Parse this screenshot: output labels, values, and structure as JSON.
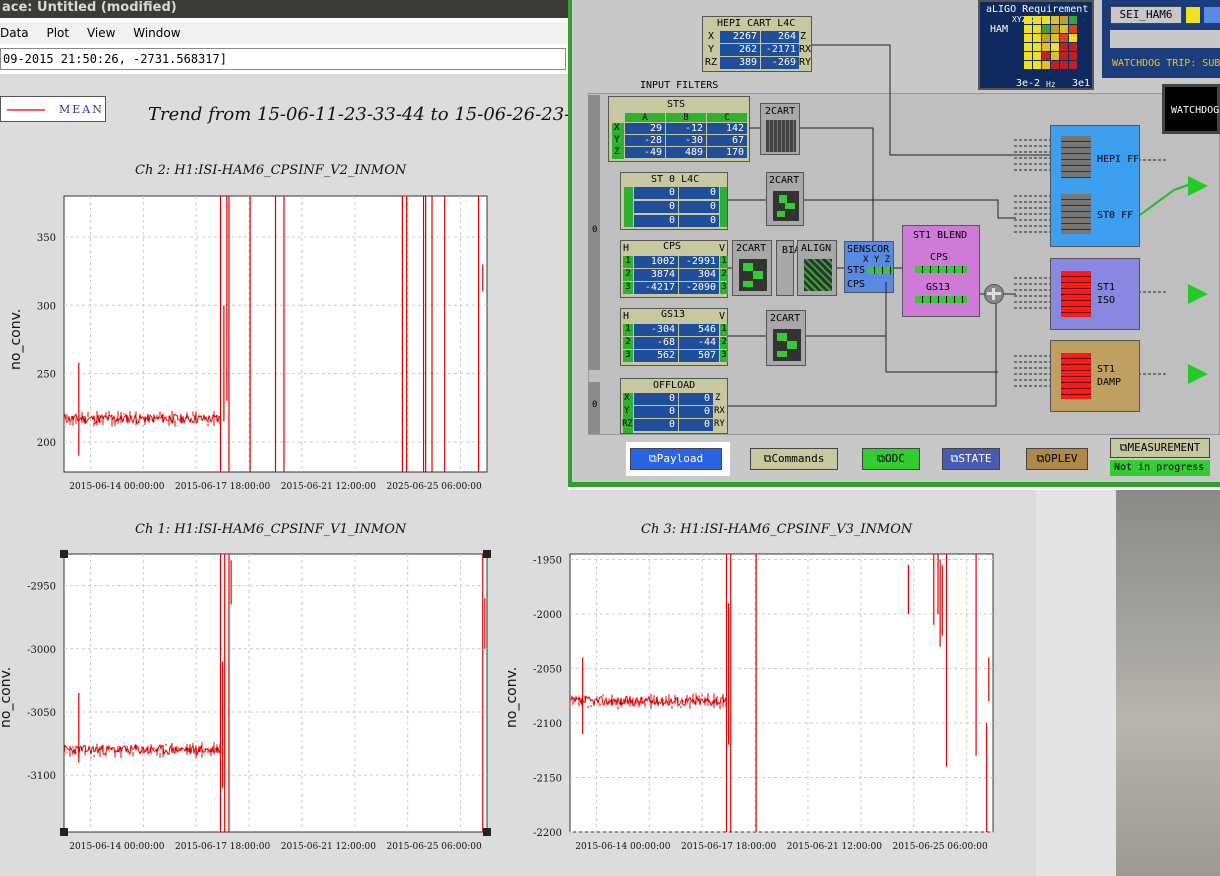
{
  "window": {
    "title": "ace: Untitled (modified)",
    "menu": [
      "Data",
      "Plot",
      "View",
      "Window"
    ],
    "readout": "09-2015 21:50:26, -2731.568317]"
  },
  "legend": {
    "label": "MEAN",
    "color": "#dd0000"
  },
  "trend_title": "Trend from 15-06-11-23-33-44 to 15-06-26-23-29-",
  "chart_data": [
    {
      "type": "line",
      "title": "Ch 2: H1:ISI-HAM6_CPSINF_V2_INMON",
      "ylabel": "no_conv.",
      "yticks": [
        200,
        250,
        300,
        350
      ],
      "xticks": [
        "2015-06-14 00:00:00",
        "2015-06-17 18:00:00",
        "2015-06-21 12:00:00",
        "2025-06-25 06:00:00"
      ],
      "ylim": [
        178,
        380
      ],
      "series": [
        {
          "color": "#dd0000",
          "baseline": 217,
          "values_description_free": true
        }
      ]
    },
    {
      "type": "line",
      "title": "Ch 1: H1:ISI-HAM6_CPSINF_V1_INMON",
      "ylabel": "no_conv.",
      "yticks": [
        -2950,
        -3000,
        -3050,
        -3100
      ],
      "xticks": [
        "2015-06-14 00:00:00",
        "2015-06-17 18:00:00",
        "2015-06-21 12:00:00",
        "2015-06-25 06:00:00"
      ],
      "ylim": [
        -3145,
        -2925
      ],
      "series": [
        {
          "color": "#dd0000",
          "baseline": -3080
        }
      ]
    },
    {
      "type": "line",
      "title": "Ch 3: H1:ISI-HAM6_CPSINF_V3_INMON",
      "ylabel": "no_conv.",
      "yticks": [
        -1950,
        -2000,
        -2050,
        -2100,
        -2150,
        -2200
      ],
      "xticks": [
        "2015-06-14 00:00:00",
        "2015-06-17 18:00:00",
        "2015-06-21 12:00:00",
        "2015-06-25 06:00:00"
      ],
      "ylim": [
        -2200,
        -1945
      ],
      "series": [
        {
          "color": "#dd0000",
          "baseline": -2080
        }
      ]
    }
  ],
  "medm": {
    "hepi_cart": {
      "title": "HEPI CART L4C",
      "rows": [
        [
          "X",
          "2267",
          "264",
          "Z"
        ],
        [
          "Y",
          "262",
          "-2171",
          "RX"
        ],
        [
          "RZ",
          "389",
          "-269",
          "RY"
        ]
      ]
    },
    "input_filters": "INPUT FILTERS",
    "sts": {
      "title": "STS",
      "cols": [
        "A",
        "B",
        "C"
      ],
      "rows": [
        [
          "X",
          "29",
          "-12",
          "142"
        ],
        [
          "Y",
          "-28",
          "-30",
          "67"
        ],
        [
          "Z",
          "-49",
          "489",
          "170"
        ]
      ]
    },
    "st0_l4c": {
      "title": "ST 0 L4C",
      "rows": [
        [
          "0",
          "0"
        ],
        [
          "0",
          "0"
        ],
        [
          "0",
          "0"
        ]
      ]
    },
    "cps": {
      "title": "CPS",
      "h": "H",
      "v": "V",
      "rows": [
        [
          "1",
          "1002",
          "-2991",
          "1"
        ],
        [
          "2",
          "3874",
          "304",
          "2"
        ],
        [
          "3",
          "-4217",
          "-2090",
          "3"
        ]
      ]
    },
    "gs13": {
      "title": "GS13",
      "h": "H",
      "v": "V",
      "rows": [
        [
          "1",
          "-304",
          "546",
          "1"
        ],
        [
          "2",
          "-68",
          "-44",
          "2"
        ],
        [
          "3",
          "562",
          "507",
          "3"
        ]
      ]
    },
    "offload": {
      "title": "OFFLOAD",
      "rows": [
        [
          "X",
          "0",
          "0",
          "Z"
        ],
        [
          "Y",
          "0",
          "0",
          "RX"
        ],
        [
          "RZ",
          "0",
          "0",
          "RY"
        ]
      ]
    },
    "cart_label": "2CART",
    "bias_label": "BIAS",
    "align_label": "ALIGN",
    "senscor": {
      "title": "SENSCOR",
      "xyz": "X Y Z",
      "sts": "STS",
      "cps": "CPS"
    },
    "st1_blend": {
      "title": "ST1 BLEND",
      "cps": "CPS",
      "gs13": "GS13"
    },
    "hepi_ff": "HEPI FF",
    "st0_ff": "ST0 FF",
    "st1_iso": "ST1\nISO",
    "st1_damp": "ST1\nDAMP",
    "aligo": {
      "title": "aLIGO Requirement",
      "ham": "HAM",
      "axes": "XYZRXRYRZ",
      "range_lo": "3e-2",
      "hz": "Hz",
      "range_hi": "3e1"
    },
    "sei_ham6": "SEI_HAM6",
    "watchdog_trip": "WATCHDOG TRIP: SUB",
    "watchdog": "WATCHDOG",
    "buttons": [
      "Payload",
      "Commands",
      "ODC",
      "STATE",
      "OPLEV",
      "MEASUREMENT"
    ],
    "measurement_status": "Not in progress",
    "zero": "0"
  }
}
